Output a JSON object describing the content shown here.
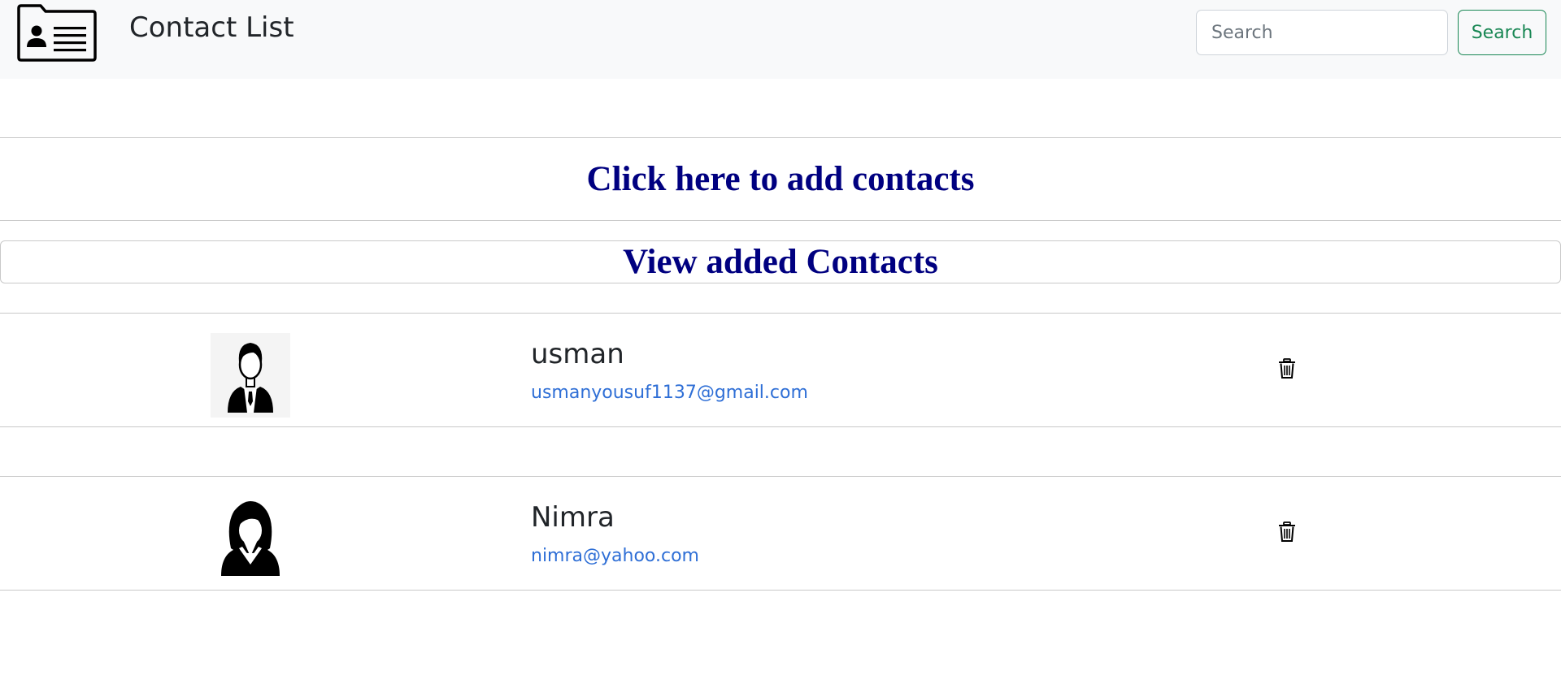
{
  "navbar": {
    "logo_icon": "contact-card-icon",
    "title": "Contact List",
    "search": {
      "placeholder": "Search",
      "value": ""
    },
    "search_button_label": "Search",
    "colors": {
      "background": "#f8f9fa",
      "search_button": "#198754"
    }
  },
  "actions": {
    "add_contacts_label": "Click here to add contacts",
    "view_contacts_label": "View added Contacts",
    "link_color": "#000080"
  },
  "contacts": [
    {
      "name": "usman",
      "email": "usmanyousuf1137@gmail.com",
      "avatar_icon": "male-avatar-icon",
      "delete_icon": "trash-icon"
    },
    {
      "name": "Nimra",
      "email": "nimra@yahoo.com",
      "avatar_icon": "female-avatar-icon",
      "delete_icon": "trash-icon"
    }
  ],
  "email_color": "#2f6fd6"
}
